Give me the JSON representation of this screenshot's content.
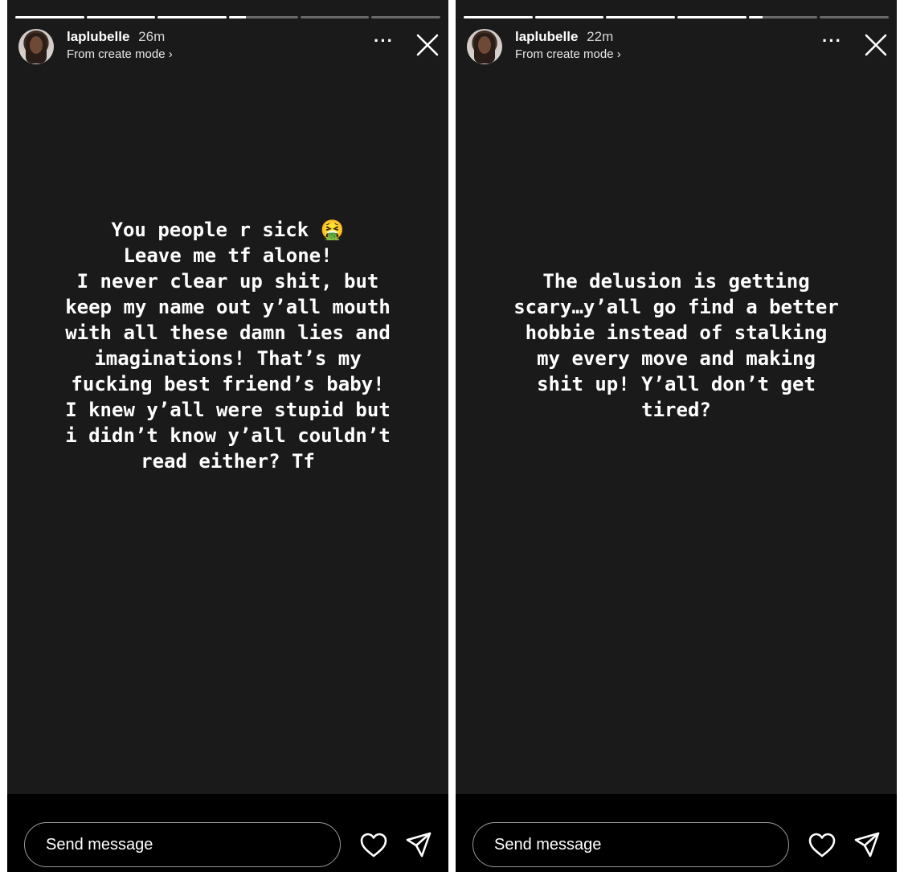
{
  "stories": [
    {
      "username": "laplubelle",
      "time": "26m",
      "subtitle": "From create mode ›",
      "text": "You people r sick 🤮\nLeave me tf alone!\nI never clear up shit, but\nkeep my name out y’all mouth\nwith all these damn lies and\nimaginations! That’s my\nfucking best friend’s baby!\nI knew y’all were stupid but\ni didn’t know y’all couldn’t\nread either? Tf",
      "more_label": "···",
      "message_placeholder": "Send message",
      "progress": [
        1,
        1,
        1,
        0.25,
        0,
        0
      ]
    },
    {
      "username": "laplubelle",
      "time": "22m",
      "subtitle": "From create mode ›",
      "text": "The delusion is getting\nscary…y’all go find a better\nhobbie instead of stalking\nmy every move and making\nshit up! Y’all don’t get\ntired?",
      "more_label": "···",
      "message_placeholder": "Send message",
      "progress": [
        1,
        1,
        1,
        1,
        0.2,
        0
      ]
    }
  ],
  "icons": {
    "close": "close-icon",
    "like": "heart-icon",
    "share": "send-icon"
  },
  "colors": {
    "background": "#1a1a1a",
    "bar": "#000000",
    "text": "#ffffff",
    "divider": "#ffffff"
  }
}
